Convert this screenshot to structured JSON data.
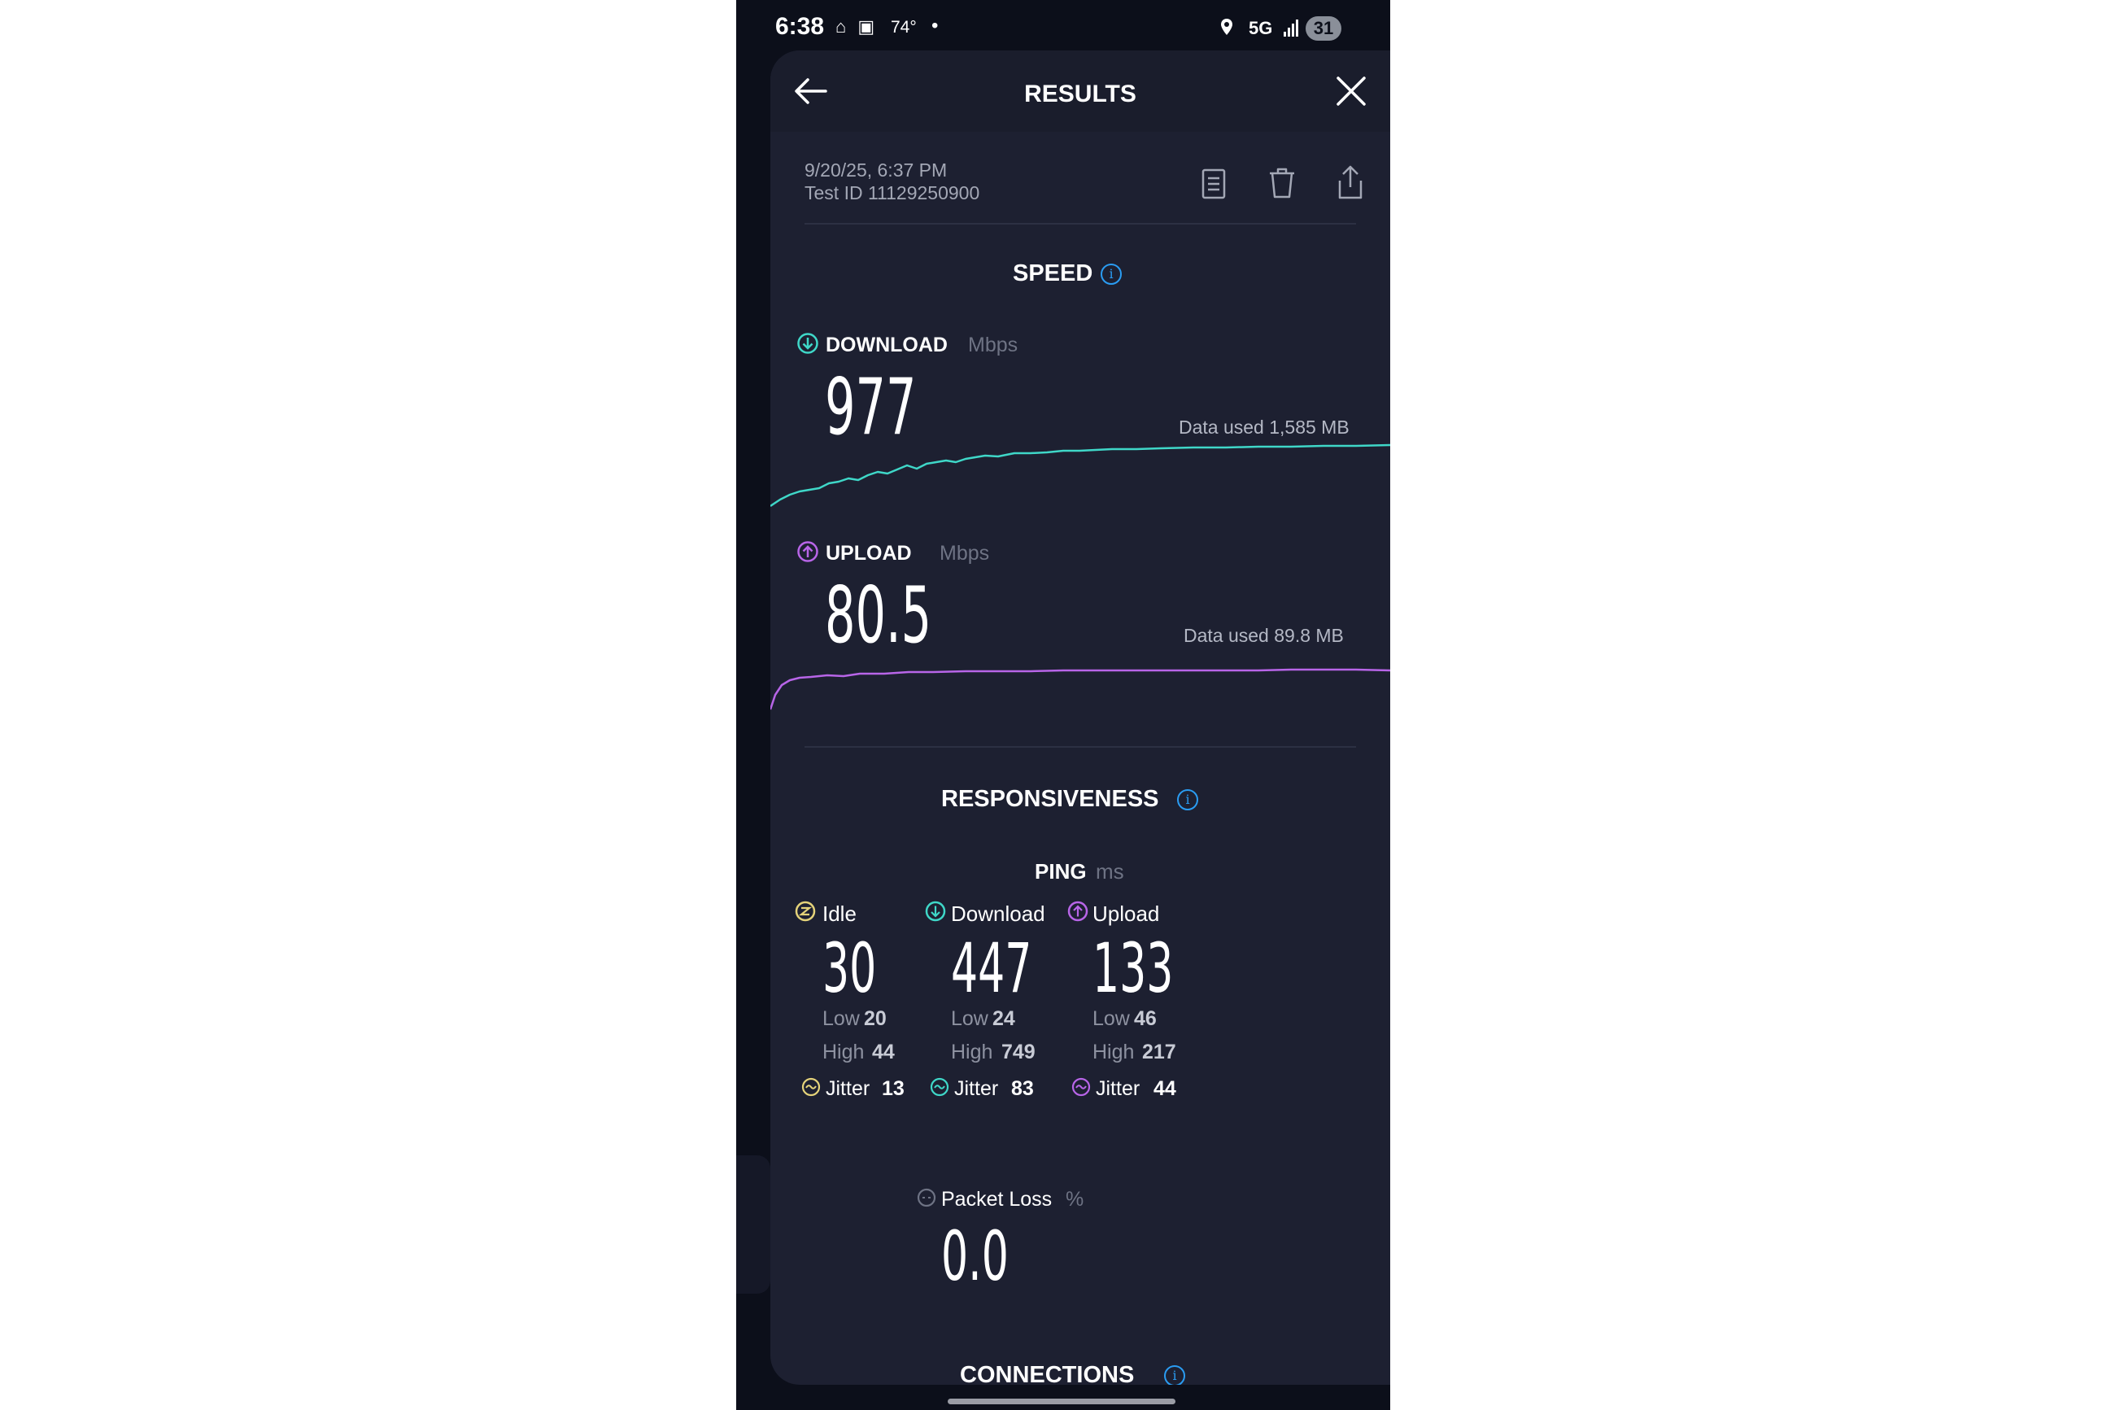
{
  "status_bar": {
    "time": "6:38",
    "left_icons": "⌂ ▣",
    "temperature": "74°",
    "dot": "•",
    "network": "5G",
    "battery": "31"
  },
  "header": {
    "title": "RESULTS",
    "back_icon": "arrow-left-icon",
    "close_icon": "close-icon"
  },
  "test": {
    "datetime": "9/20/25, 6:37 PM",
    "test_id": "Test ID 11129250900",
    "actions": [
      "results-list-icon",
      "trash-icon",
      "share-icon"
    ]
  },
  "speed": {
    "title": "SPEED",
    "download": {
      "label": "DOWNLOAD",
      "unit": "Mbps",
      "value": "977",
      "data_used": "Data used 1,585 MB",
      "color": "#3fd7c8"
    },
    "upload": {
      "label": "UPLOAD",
      "unit": "Mbps",
      "value": "80.5",
      "data_used": "Data used 89.8 MB",
      "color": "#b865e8"
    }
  },
  "responsiveness": {
    "title": "RESPONSIVENESS",
    "ping_label": "PING",
    "ping_unit": "ms",
    "columns": [
      {
        "label": "Idle",
        "value": "30",
        "low_label": "Low",
        "low": "20",
        "high_label": "High",
        "high": "44",
        "jitter_label": "Jitter",
        "jitter": "13",
        "color": "#e5d37a"
      },
      {
        "label": "Download",
        "value": "447",
        "low_label": "Low",
        "low": "24",
        "high_label": "High",
        "high": "749",
        "jitter_label": "Jitter",
        "jitter": "83",
        "color": "#3fd7c8"
      },
      {
        "label": "Upload",
        "value": "133",
        "low_label": "Low",
        "low": "46",
        "high_label": "High",
        "high": "217",
        "jitter_label": "Jitter",
        "jitter": "44",
        "color": "#b865e8"
      }
    ],
    "packet_loss": {
      "label": "Packet Loss",
      "unit": "%",
      "value": "0.0"
    }
  },
  "connections": {
    "title": "CONNECTIONS"
  },
  "colors": {
    "panel": "#1d2031",
    "background": "#0c0f1a",
    "info": "#2a9cf2"
  }
}
